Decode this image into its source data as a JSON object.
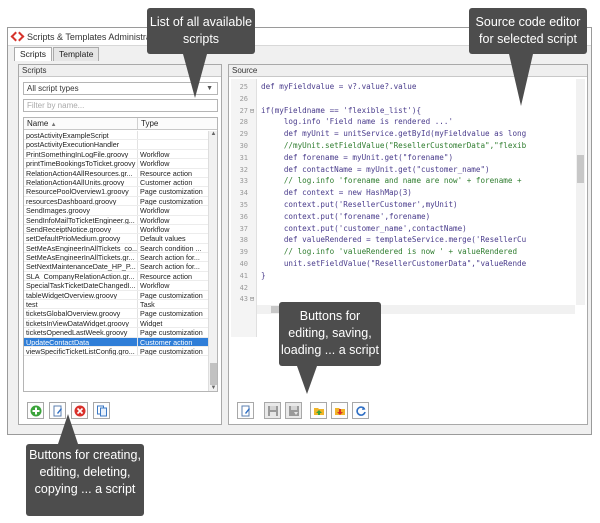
{
  "window": {
    "title": "Scripts & Templates Administration"
  },
  "tabs": [
    {
      "label": "Scripts"
    },
    {
      "label": "Template"
    }
  ],
  "scripts_panel": {
    "header": "Scripts",
    "type_select": "All script types",
    "filter_placeholder": "Filter by name...",
    "columns": {
      "name": "Name",
      "type": "Type"
    },
    "rows": [
      {
        "name": "postActivityExampleScript",
        "type": ""
      },
      {
        "name": "postActivityExecutionHandler",
        "type": ""
      },
      {
        "name": "PrintSomethingInLogFile.groovy",
        "type": "Workflow"
      },
      {
        "name": "printTimeBookingsToTicket.groovy",
        "type": "Workflow"
      },
      {
        "name": "RelationAction4AllResources.gr...",
        "type": "Resource action"
      },
      {
        "name": "RelationAction4AllUnits.groovy",
        "type": "Customer action"
      },
      {
        "name": "ResourcePoolOverview1.groovy",
        "type": "Page customization"
      },
      {
        "name": "resourcesDashboard.groovy",
        "type": "Page customization"
      },
      {
        "name": "SendImages.groovy",
        "type": "Workflow"
      },
      {
        "name": "SendInfoMailToTicketEngineer.g...",
        "type": "Workflow"
      },
      {
        "name": "SendReceiptNotice.groovy",
        "type": "Workflow"
      },
      {
        "name": "setDefaultPrioMedium.groovy",
        "type": "Default values"
      },
      {
        "name": "SetMeAsEngineerInAllTickets_co...",
        "type": "Search condition ..."
      },
      {
        "name": "SetMeAsEngineerInAllTickets.gr...",
        "type": "Search action for..."
      },
      {
        "name": "SetNextMaintenanceDate_HP_P...",
        "type": "Search action for..."
      },
      {
        "name": "SLA_CompanyRelationAction.gr...",
        "type": "Resource action"
      },
      {
        "name": "SpecialTaskTicketDateChangedI...",
        "type": "Workflow"
      },
      {
        "name": "tableWidgetOverview.groovy",
        "type": "Page customization"
      },
      {
        "name": "test",
        "type": "Task"
      },
      {
        "name": "ticketsGlobalOverview.groovy",
        "type": "Page customization"
      },
      {
        "name": "ticketsInViewDataWidget.groovy",
        "type": "Widget"
      },
      {
        "name": "ticketsOpenedLastWeek.groovy",
        "type": "Page customization"
      },
      {
        "name": "UpdateContactData",
        "type": "Customer action"
      },
      {
        "name": "viewSpecificTicketListConfig.gro...",
        "type": "Page customization"
      }
    ],
    "selected_index": 22
  },
  "source_panel": {
    "header": "Source",
    "lines": [
      {
        "n": "25",
        "fold": "",
        "text": "def myFieldvalue = v?.value?.value"
      },
      {
        "n": "26",
        "fold": "",
        "text": ""
      },
      {
        "n": "27",
        "fold": "⊟",
        "text": "if(myFieldname == 'flexible_list'){"
      },
      {
        "n": "28",
        "fold": "",
        "text": "     log.info 'Field name is rendered ...'"
      },
      {
        "n": "29",
        "fold": "",
        "text": "     def myUnit = unitService.getById(myFieldvalue as long"
      },
      {
        "n": "30",
        "fold": "",
        "text": "     //myUnit.setFieldValue(\"ResellerCustomerData\",\"flexib"
      },
      {
        "n": "31",
        "fold": "",
        "text": "     def forename = myUnit.get(\"forename\")"
      },
      {
        "n": "32",
        "fold": "",
        "text": "     def contactName = myUnit.get(\"customer_name\")"
      },
      {
        "n": "33",
        "fold": "",
        "text": "     // log.info 'forename and name are now' + forename +"
      },
      {
        "n": "34",
        "fold": "",
        "text": "     def context = new HashMap(3)"
      },
      {
        "n": "35",
        "fold": "",
        "text": "     context.put('ResellerCustomer',myUnit)"
      },
      {
        "n": "36",
        "fold": "",
        "text": "     context.put('forename',forename)"
      },
      {
        "n": "37",
        "fold": "",
        "text": "     context.put('customer_name',contactName)"
      },
      {
        "n": "38",
        "fold": "",
        "text": "     def valueRendered = templateService.merge('ResellerCu"
      },
      {
        "n": "39",
        "fold": "",
        "text": "     // log.info 'valueRendered is now ' + valueRendered"
      },
      {
        "n": "40",
        "fold": "",
        "text": "     unit.setFieldValue(\"ResellerCustomerData\",\"valueRende"
      },
      {
        "n": "41",
        "fold": "",
        "text": "}"
      },
      {
        "n": "42",
        "fold": "",
        "text": ""
      },
      {
        "n": "43",
        "fold": "⊟",
        "text": ""
      }
    ]
  },
  "colors": {
    "keyword": "#1b24c4",
    "string": "#b0146a",
    "comment": "#2f7d2f",
    "selection": "#2f7ed8",
    "callout_bg": "#4d4d4d"
  },
  "left_buttons": [
    {
      "name": "create-script-button",
      "icon": "plus-circle-icon"
    },
    {
      "name": "edit-script-button",
      "icon": "edit-document-icon"
    },
    {
      "name": "delete-script-button",
      "icon": "delete-circle-icon"
    },
    {
      "name": "copy-script-button",
      "icon": "copy-icon"
    }
  ],
  "right_buttons": [
    {
      "name": "edit-source-button",
      "icon": "edit-document-icon"
    },
    {
      "name": "save-button",
      "icon": "floppy-icon",
      "disabled": true
    },
    {
      "name": "save-as-button",
      "icon": "floppy-arrow-icon",
      "disabled": true
    },
    {
      "name": "load-button",
      "icon": "folder-up-icon"
    },
    {
      "name": "import-button",
      "icon": "folder-down-icon"
    },
    {
      "name": "reload-button",
      "icon": "refresh-icon"
    }
  ],
  "callouts": {
    "list": "List of all available scripts",
    "editor": "Source code editor for selected script",
    "edit_buttons": "Buttons for editing, saving, loading ... a script",
    "crud_buttons": "Buttons for creating, editing, deleting, copying ... a script"
  }
}
